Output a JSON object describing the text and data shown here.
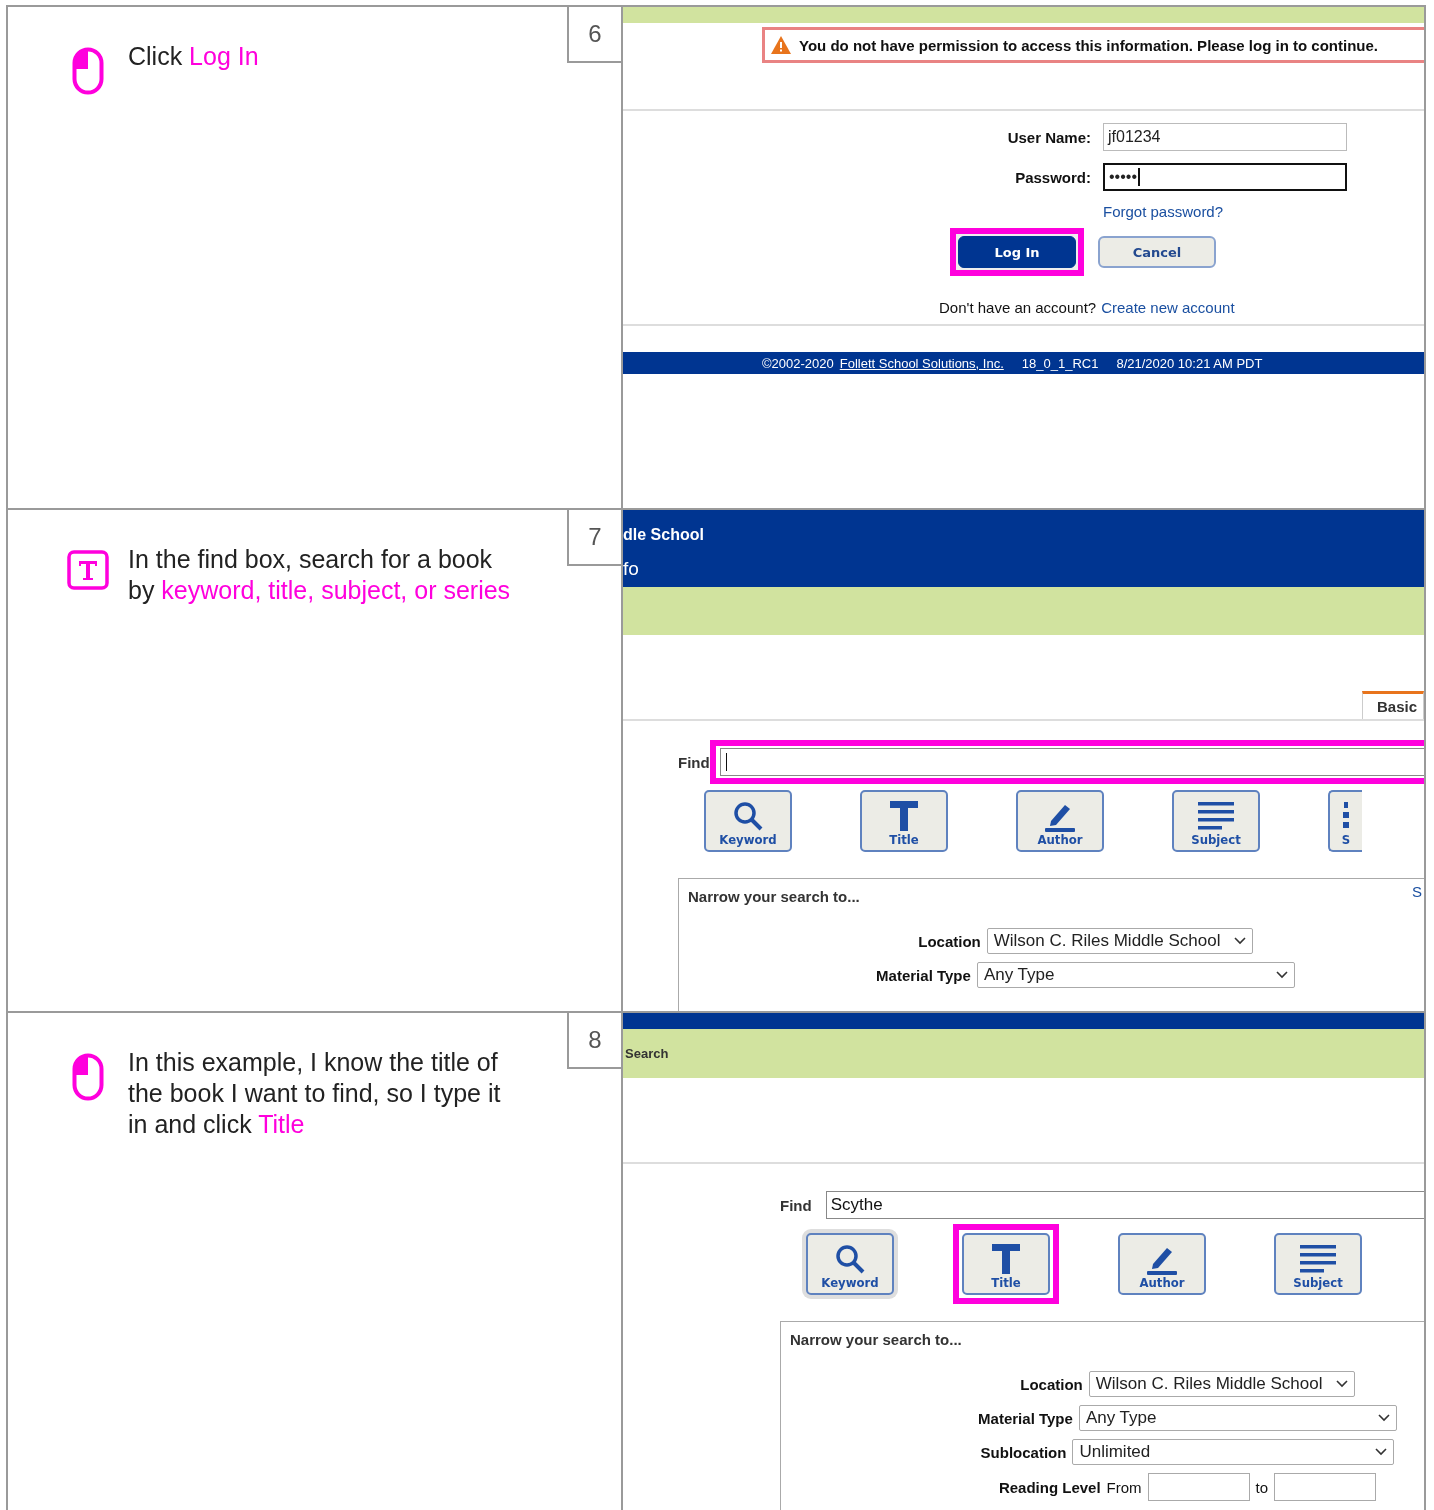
{
  "steps": [
    {
      "number": "6",
      "kind": "click",
      "instruction": [
        {
          "text": "Click ",
          "highlight": false
        },
        {
          "text": "Log In",
          "highlight": true
        }
      ],
      "screenshot": {
        "kind": "login",
        "alert": "You do not have permission to access this information. Please log in to continue.",
        "fields": [
          {
            "label": "User Name:",
            "value": "jf01234",
            "focused": false
          },
          {
            "label": "Password:",
            "value": "•••••",
            "focused": true
          }
        ],
        "forgot_link": "Forgot password?",
        "buttons": [
          {
            "label": "Log In",
            "primary": true,
            "highlighted": true
          },
          {
            "label": "Cancel",
            "primary": false,
            "highlighted": false
          }
        ],
        "signup_prompt": "Don't have an account?",
        "signup_link": "Create new account",
        "footer": {
          "copyright": "©2002-2020",
          "company_link": "Follett School Solutions, Inc.",
          "version": "18_0_1_RC1",
          "timestamp": "8/21/2020 10:21 AM PDT"
        }
      }
    },
    {
      "number": "7",
      "kind": "type",
      "instruction": [
        {
          "text": "In the find box, search for a book by ",
          "highlight": false
        },
        {
          "text": "keyword, title, subject, or series",
          "highlight": true
        }
      ],
      "screenshot": {
        "kind": "find",
        "header_lines": [
          "dle School",
          "fo"
        ],
        "tab": "Basic",
        "find": {
          "label": "Find",
          "focused": true,
          "highlighted": true
        },
        "search_buttons": [
          {
            "label": "Keyword",
            "kind": "keyword",
            "highlighted": false,
            "hovered": false
          },
          {
            "label": "Title",
            "kind": "title",
            "highlighted": false,
            "hovered": false
          },
          {
            "label": "Author",
            "kind": "author",
            "highlighted": false,
            "hovered": false
          },
          {
            "label": "Subject",
            "kind": "subject",
            "highlighted": false,
            "hovered": false
          },
          {
            "label": "S",
            "kind": "series",
            "highlighted": false,
            "hovered": false
          }
        ],
        "narrow": {
          "title": "Narrow your search to...",
          "corner_link": "S",
          "filters": [
            {
              "label": "Location",
              "kind": "select",
              "value": "Wilson C. Riles Middle School"
            },
            {
              "label": "Material Type",
              "kind": "select",
              "value": "Any Type"
            }
          ]
        }
      }
    },
    {
      "number": "8",
      "kind": "click",
      "instruction": [
        {
          "text": "In this example, I know the title of the book I want to find, so I type it in and click ",
          "highlight": false
        },
        {
          "text": "Title",
          "highlight": true
        }
      ],
      "screenshot": {
        "kind": "find",
        "breadcrumb": "Search",
        "find": {
          "label": "Find",
          "value": "Scythe",
          "focused": false,
          "highlighted": false
        },
        "search_buttons": [
          {
            "label": "Keyword",
            "kind": "keyword",
            "highlighted": false,
            "hovered": true
          },
          {
            "label": "Title",
            "kind": "title",
            "highlighted": true,
            "hovered": false
          },
          {
            "label": "Author",
            "kind": "author",
            "highlighted": false,
            "hovered": false
          },
          {
            "label": "Subject",
            "kind": "subject",
            "highlighted": false,
            "hovered": false
          }
        ],
        "narrow": {
          "title": "Narrow your search to...",
          "filters": [
            {
              "label": "Location",
              "kind": "select",
              "value": "Wilson C. Riles Middle School"
            },
            {
              "label": "Material Type",
              "kind": "select",
              "value": "Any Type"
            },
            {
              "label": "Sublocation",
              "kind": "select",
              "value": "Unlimited"
            },
            {
              "label": "Reading Level",
              "kind": "range",
              "from_label": "From",
              "to_label": "to"
            }
          ]
        }
      }
    }
  ]
}
